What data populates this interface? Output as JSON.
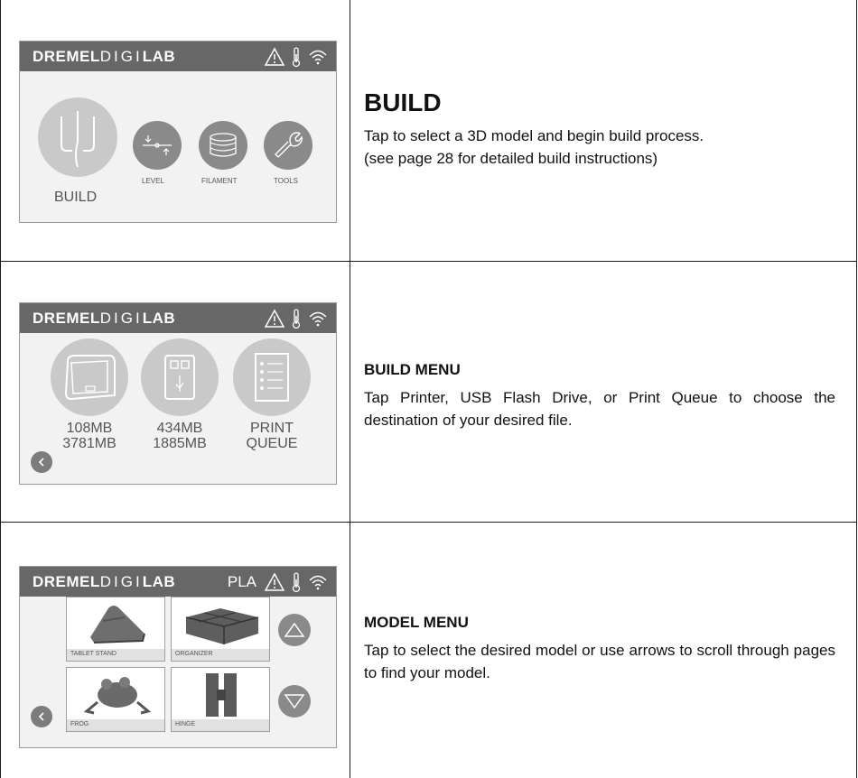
{
  "brand": {
    "bold": "DREMEL",
    "thin_a": "DIGI",
    "thin_b": "LAB"
  },
  "rows": [
    {
      "heading": "BUILD",
      "text_lines": [
        "Tap to select a 3D model and begin build process.",
        "(see page 28 for detailed build instructions)"
      ],
      "screen": {
        "build_label": "BUILD",
        "level_label": "LEVEL",
        "filament_label": "FILAMENT",
        "tools_label": "TOOLS"
      }
    },
    {
      "heading": "BUILD MENU",
      "text": "Tap Printer, USB Flash Drive, or Print Queue to choose the destination of your desired file.",
      "screen": {
        "printer_line1": "108MB",
        "printer_line2": "3781MB",
        "usb_line1": "434MB",
        "usb_line2": "1885MB",
        "queue_line1": "PRINT",
        "queue_line2": "QUEUE"
      }
    },
    {
      "heading": "MODEL MENU",
      "text": "Tap to select the desired model or use arrows to scroll through pages to find your model.",
      "screen": {
        "material": "PLA",
        "models": [
          "TABLET STAND",
          "ORGANIZER",
          "FROG",
          "HINGE"
        ]
      }
    }
  ],
  "icons": [
    "warning-icon",
    "thermometer-icon",
    "wifi-icon",
    "build-icon",
    "level-icon",
    "filament-icon",
    "wrench-icon",
    "printer-icon",
    "usb-icon",
    "queue-icon",
    "back-icon",
    "up-arrow-icon",
    "down-arrow-icon"
  ]
}
